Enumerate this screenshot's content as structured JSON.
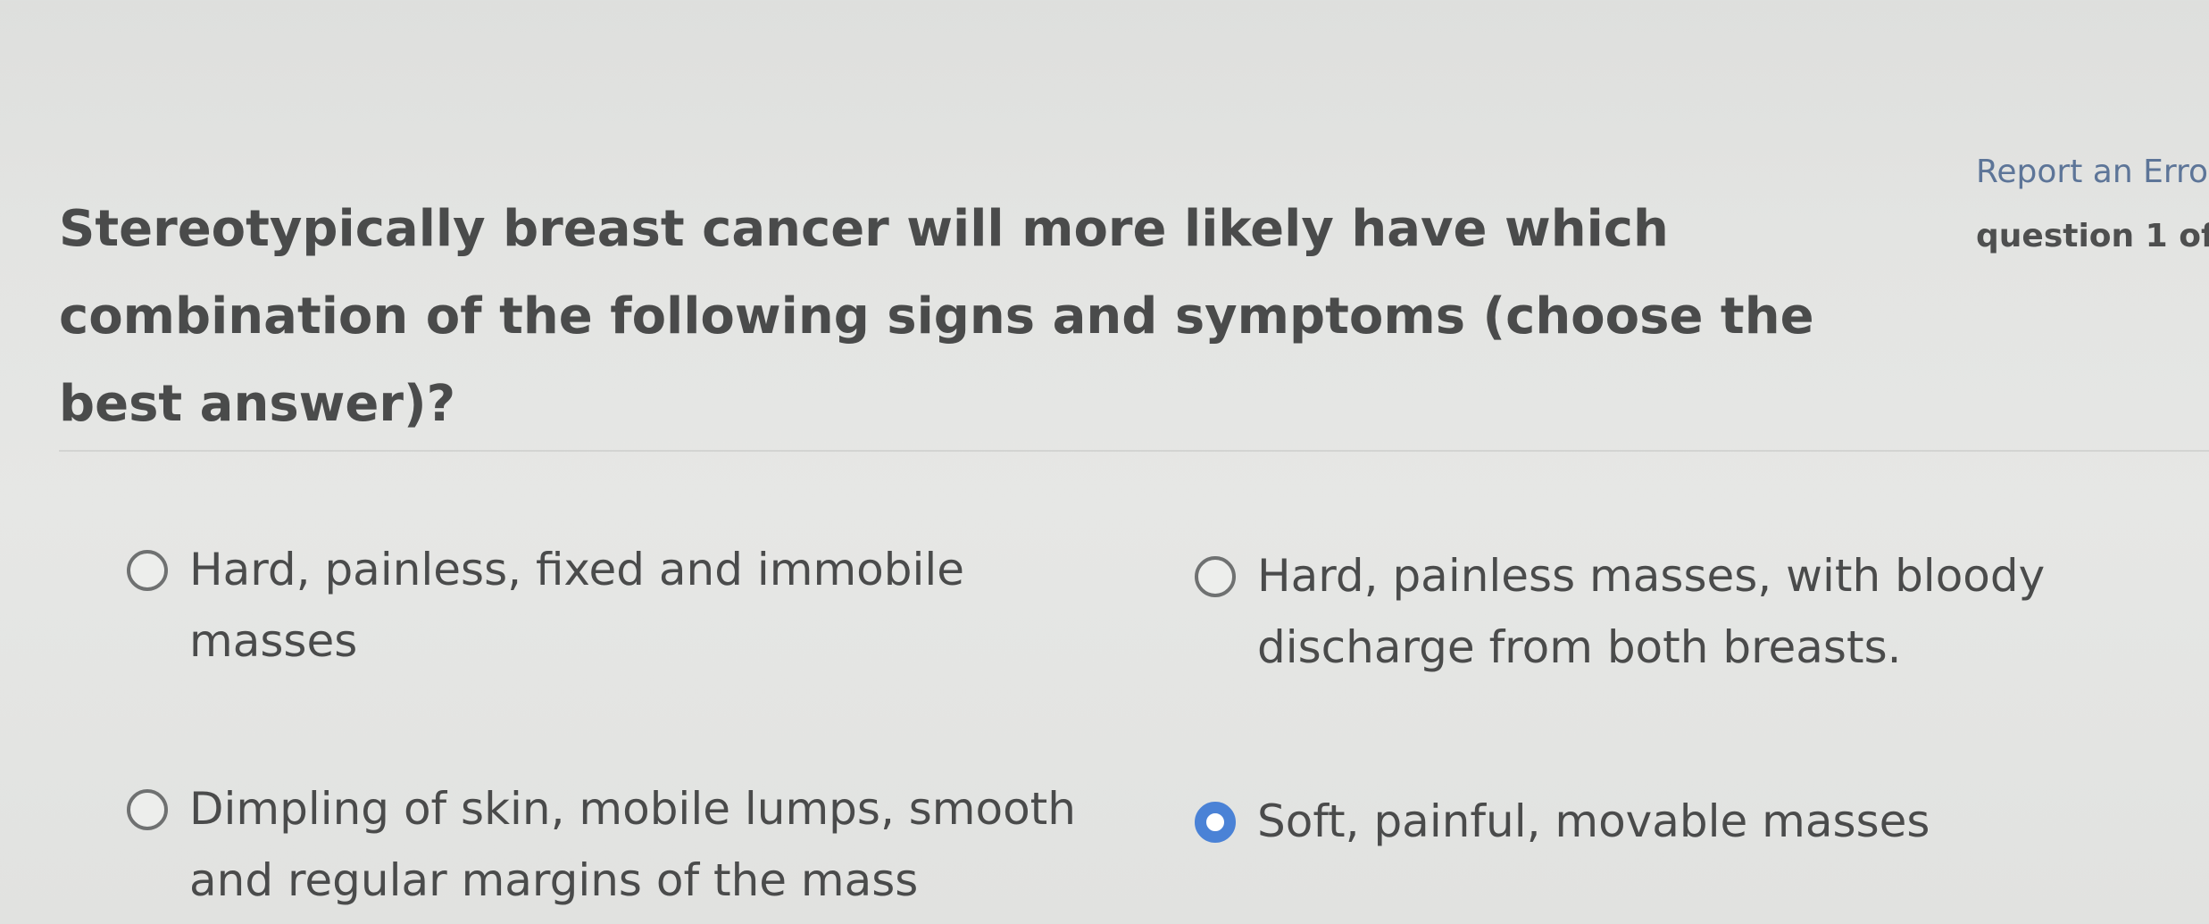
{
  "question": {
    "text": "Stereotypically breast cancer will more likely have which combination of the following signs and symptoms (choose the best answer)?"
  },
  "header": {
    "report_link": "Report an Erro",
    "counter": "question 1 of"
  },
  "options": [
    {
      "label": "Hard, painless, fixed and immobile masses",
      "selected": false
    },
    {
      "label": "Hard, painless masses, with bloody discharge from both breasts.",
      "selected": false
    },
    {
      "label": "Dimpling of skin, mobile lumps, smooth and regular margins of the mass",
      "selected": false
    },
    {
      "label": "Soft, painful, movable masses",
      "selected": true
    }
  ],
  "colors": {
    "selected_radio": "#4a82d6",
    "link": "#5d7598",
    "text": "#4a4b4b"
  }
}
